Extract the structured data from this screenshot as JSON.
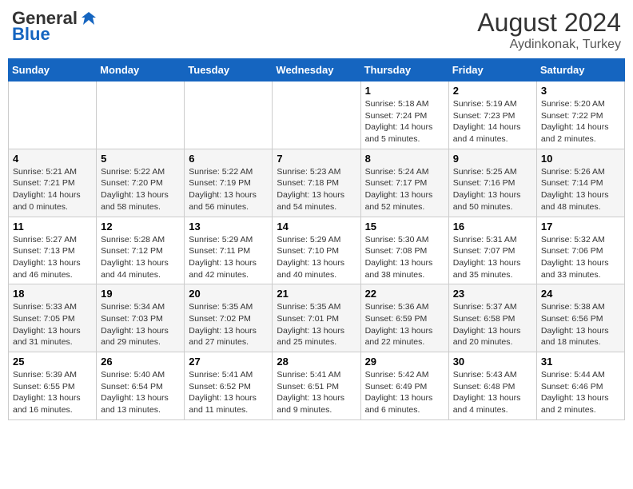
{
  "header": {
    "logo_general": "General",
    "logo_blue": "Blue",
    "month_year": "August 2024",
    "location": "Aydinkonak, Turkey"
  },
  "days_of_week": [
    "Sunday",
    "Monday",
    "Tuesday",
    "Wednesday",
    "Thursday",
    "Friday",
    "Saturday"
  ],
  "weeks": [
    [
      {
        "day": "",
        "info": ""
      },
      {
        "day": "",
        "info": ""
      },
      {
        "day": "",
        "info": ""
      },
      {
        "day": "",
        "info": ""
      },
      {
        "day": "1",
        "info": "Sunrise: 5:18 AM\nSunset: 7:24 PM\nDaylight: 14 hours\nand 5 minutes."
      },
      {
        "day": "2",
        "info": "Sunrise: 5:19 AM\nSunset: 7:23 PM\nDaylight: 14 hours\nand 4 minutes."
      },
      {
        "day": "3",
        "info": "Sunrise: 5:20 AM\nSunset: 7:22 PM\nDaylight: 14 hours\nand 2 minutes."
      }
    ],
    [
      {
        "day": "4",
        "info": "Sunrise: 5:21 AM\nSunset: 7:21 PM\nDaylight: 14 hours\nand 0 minutes."
      },
      {
        "day": "5",
        "info": "Sunrise: 5:22 AM\nSunset: 7:20 PM\nDaylight: 13 hours\nand 58 minutes."
      },
      {
        "day": "6",
        "info": "Sunrise: 5:22 AM\nSunset: 7:19 PM\nDaylight: 13 hours\nand 56 minutes."
      },
      {
        "day": "7",
        "info": "Sunrise: 5:23 AM\nSunset: 7:18 PM\nDaylight: 13 hours\nand 54 minutes."
      },
      {
        "day": "8",
        "info": "Sunrise: 5:24 AM\nSunset: 7:17 PM\nDaylight: 13 hours\nand 52 minutes."
      },
      {
        "day": "9",
        "info": "Sunrise: 5:25 AM\nSunset: 7:16 PM\nDaylight: 13 hours\nand 50 minutes."
      },
      {
        "day": "10",
        "info": "Sunrise: 5:26 AM\nSunset: 7:14 PM\nDaylight: 13 hours\nand 48 minutes."
      }
    ],
    [
      {
        "day": "11",
        "info": "Sunrise: 5:27 AM\nSunset: 7:13 PM\nDaylight: 13 hours\nand 46 minutes."
      },
      {
        "day": "12",
        "info": "Sunrise: 5:28 AM\nSunset: 7:12 PM\nDaylight: 13 hours\nand 44 minutes."
      },
      {
        "day": "13",
        "info": "Sunrise: 5:29 AM\nSunset: 7:11 PM\nDaylight: 13 hours\nand 42 minutes."
      },
      {
        "day": "14",
        "info": "Sunrise: 5:29 AM\nSunset: 7:10 PM\nDaylight: 13 hours\nand 40 minutes."
      },
      {
        "day": "15",
        "info": "Sunrise: 5:30 AM\nSunset: 7:08 PM\nDaylight: 13 hours\nand 38 minutes."
      },
      {
        "day": "16",
        "info": "Sunrise: 5:31 AM\nSunset: 7:07 PM\nDaylight: 13 hours\nand 35 minutes."
      },
      {
        "day": "17",
        "info": "Sunrise: 5:32 AM\nSunset: 7:06 PM\nDaylight: 13 hours\nand 33 minutes."
      }
    ],
    [
      {
        "day": "18",
        "info": "Sunrise: 5:33 AM\nSunset: 7:05 PM\nDaylight: 13 hours\nand 31 minutes."
      },
      {
        "day": "19",
        "info": "Sunrise: 5:34 AM\nSunset: 7:03 PM\nDaylight: 13 hours\nand 29 minutes."
      },
      {
        "day": "20",
        "info": "Sunrise: 5:35 AM\nSunset: 7:02 PM\nDaylight: 13 hours\nand 27 minutes."
      },
      {
        "day": "21",
        "info": "Sunrise: 5:35 AM\nSunset: 7:01 PM\nDaylight: 13 hours\nand 25 minutes."
      },
      {
        "day": "22",
        "info": "Sunrise: 5:36 AM\nSunset: 6:59 PM\nDaylight: 13 hours\nand 22 minutes."
      },
      {
        "day": "23",
        "info": "Sunrise: 5:37 AM\nSunset: 6:58 PM\nDaylight: 13 hours\nand 20 minutes."
      },
      {
        "day": "24",
        "info": "Sunrise: 5:38 AM\nSunset: 6:56 PM\nDaylight: 13 hours\nand 18 minutes."
      }
    ],
    [
      {
        "day": "25",
        "info": "Sunrise: 5:39 AM\nSunset: 6:55 PM\nDaylight: 13 hours\nand 16 minutes."
      },
      {
        "day": "26",
        "info": "Sunrise: 5:40 AM\nSunset: 6:54 PM\nDaylight: 13 hours\nand 13 minutes."
      },
      {
        "day": "27",
        "info": "Sunrise: 5:41 AM\nSunset: 6:52 PM\nDaylight: 13 hours\nand 11 minutes."
      },
      {
        "day": "28",
        "info": "Sunrise: 5:41 AM\nSunset: 6:51 PM\nDaylight: 13 hours\nand 9 minutes."
      },
      {
        "day": "29",
        "info": "Sunrise: 5:42 AM\nSunset: 6:49 PM\nDaylight: 13 hours\nand 6 minutes."
      },
      {
        "day": "30",
        "info": "Sunrise: 5:43 AM\nSunset: 6:48 PM\nDaylight: 13 hours\nand 4 minutes."
      },
      {
        "day": "31",
        "info": "Sunrise: 5:44 AM\nSunset: 6:46 PM\nDaylight: 13 hours\nand 2 minutes."
      }
    ]
  ]
}
